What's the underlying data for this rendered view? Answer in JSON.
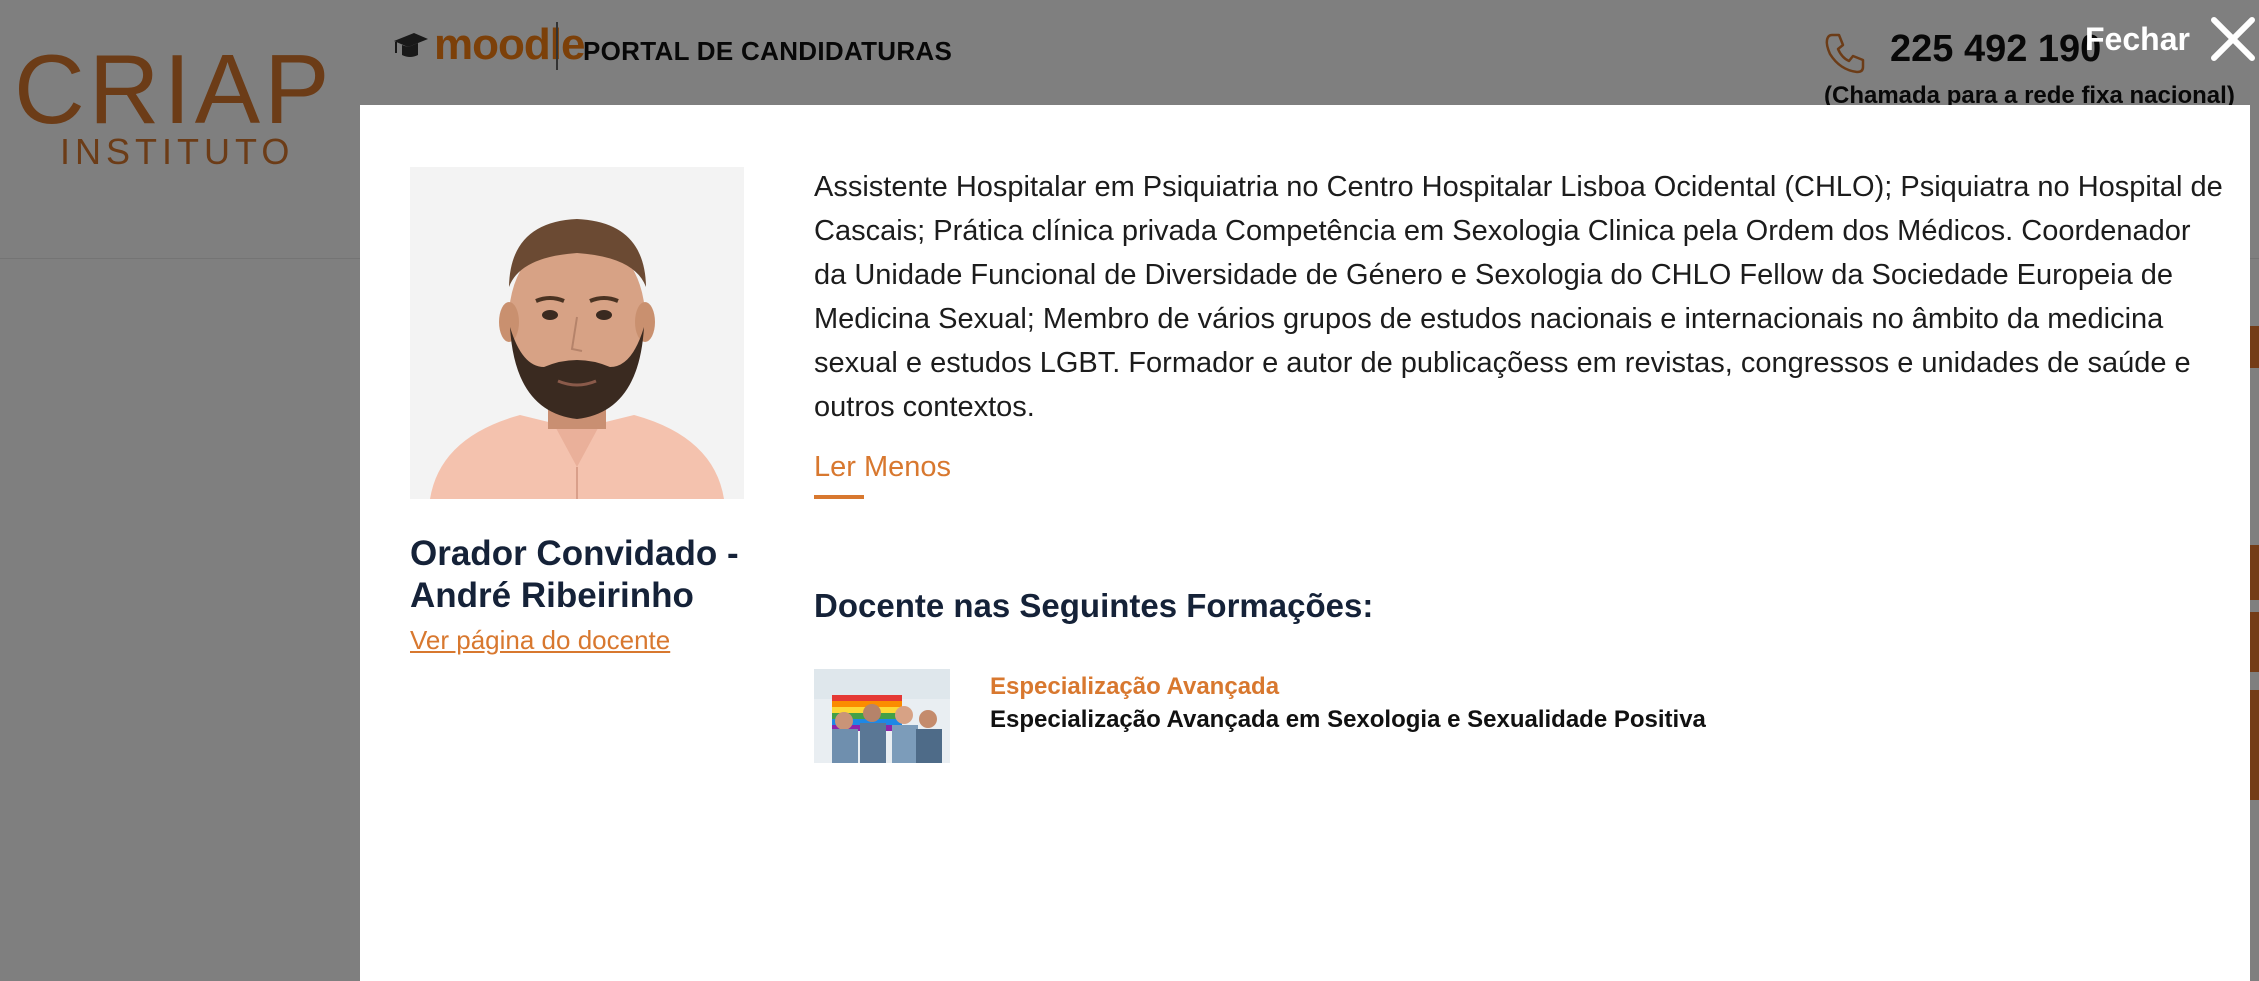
{
  "site": {
    "logo_main": "CRIAP",
    "logo_sub": "INSTITUTO",
    "moodle_label": "moodle",
    "portal_label": "PORTAL DE CANDIDATURAS",
    "phone_number": "225 492 190",
    "phone_note": "(Chamada para a rede fixa nacional)",
    "accent_color": "#d8782f"
  },
  "modal": {
    "close_label": "Fechar",
    "speaker_name": "Orador Convidado - André Ribeirinho",
    "teacher_link": "Ver página do docente",
    "bio": "Assistente Hospitalar em Psiquiatria no Centro Hospitalar Lisboa Ocidental (CHLO); Psiquiatra no Hospital de Cascais; Prática clínica privada Competência em Sexologia Clinica pela Ordem dos Médicos. Coordenador da Unidade Funcional de Diversidade de Género e Sexologia do CHLO Fellow da Sociedade Europeia de Medicina Sexual; Membro de vários grupos de estudos nacionais e internacionais no âmbito da medicina sexual e estudos LGBT. Formador e autor de publicaçõess em revistas, congressos e unidades de saúde e outros contextos.",
    "read_less": "Ler Menos",
    "courses_heading": "Docente nas Seguintes Formações:",
    "courses": [
      {
        "category": "Especialização Avançada",
        "title": "Especialização Avançada em Sexologia e Sexualidade Positiva"
      }
    ]
  }
}
